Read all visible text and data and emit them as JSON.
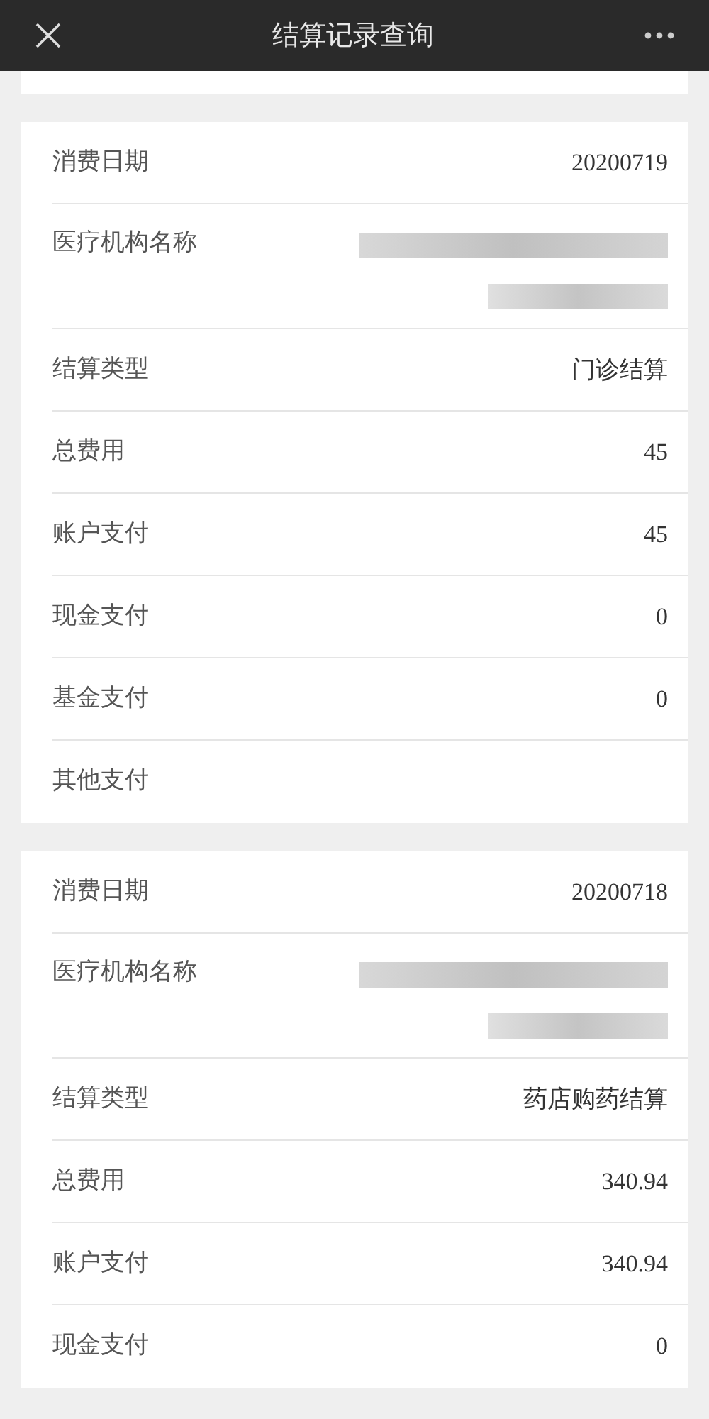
{
  "header": {
    "title": "结算记录查询"
  },
  "records": [
    {
      "rows": [
        {
          "kind": "text",
          "label": "消费日期",
          "value": "20200719"
        },
        {
          "kind": "blurred",
          "label": "医疗机构名称"
        },
        {
          "kind": "text",
          "label": "结算类型",
          "value": "门诊结算"
        },
        {
          "kind": "text",
          "label": "总费用",
          "value": "45"
        },
        {
          "kind": "text",
          "label": "账户支付",
          "value": "45"
        },
        {
          "kind": "text",
          "label": "现金支付",
          "value": "0"
        },
        {
          "kind": "text",
          "label": "基金支付",
          "value": "0"
        },
        {
          "kind": "text",
          "label": "其他支付"
        }
      ]
    },
    {
      "rows": [
        {
          "kind": "text",
          "label": "消费日期",
          "value": "20200718"
        },
        {
          "kind": "blurred",
          "label": "医疗机构名称"
        },
        {
          "kind": "text",
          "label": "结算类型",
          "value": "药店购药结算"
        },
        {
          "kind": "text",
          "label": "总费用",
          "value": "340.94"
        },
        {
          "kind": "text",
          "label": "账户支付",
          "value": "340.94"
        },
        {
          "kind": "text",
          "label": "现金支付",
          "value": "0"
        }
      ]
    }
  ]
}
